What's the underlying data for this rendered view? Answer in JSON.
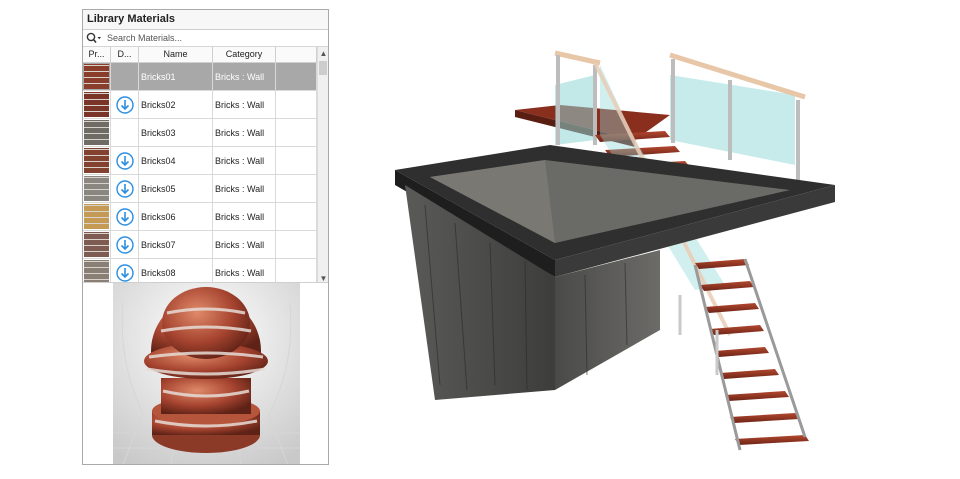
{
  "panel": {
    "title": "Library Materials",
    "search_placeholder": "Search Materials...",
    "columns": [
      "Pr...",
      "D...",
      "Name",
      "Category"
    ],
    "rows": [
      {
        "name": "Bricks01",
        "category": "Bricks : Wall",
        "download": false,
        "selected": true,
        "swatch": "#8b3d2c"
      },
      {
        "name": "Bricks02",
        "category": "Bricks : Wall",
        "download": true,
        "selected": false,
        "swatch": "#7a3428"
      },
      {
        "name": "Bricks03",
        "category": "Bricks : Wall",
        "download": false,
        "selected": false,
        "swatch": "#6f6c66"
      },
      {
        "name": "Bricks04",
        "category": "Bricks : Wall",
        "download": true,
        "selected": false,
        "swatch": "#83412f"
      },
      {
        "name": "Bricks05",
        "category": "Bricks : Wall",
        "download": true,
        "selected": false,
        "swatch": "#8a8680"
      },
      {
        "name": "Bricks06",
        "category": "Bricks : Wall",
        "download": true,
        "selected": false,
        "swatch": "#c49a55"
      },
      {
        "name": "Bricks07",
        "category": "Bricks : Wall",
        "download": true,
        "selected": false,
        "swatch": "#7e5c52"
      },
      {
        "name": "Bricks08",
        "category": "Bricks : Wall",
        "download": true,
        "selected": false,
        "swatch": "#8a7f74"
      }
    ]
  },
  "colors": {
    "selection": "#a8a8a8",
    "download_icon": "#2b8ee0",
    "brick": "#a5432f"
  },
  "icons": {
    "search": "search-icon",
    "download": "download-icon",
    "scroll_up": "chevron-up-icon",
    "scroll_down": "chevron-down-icon"
  }
}
